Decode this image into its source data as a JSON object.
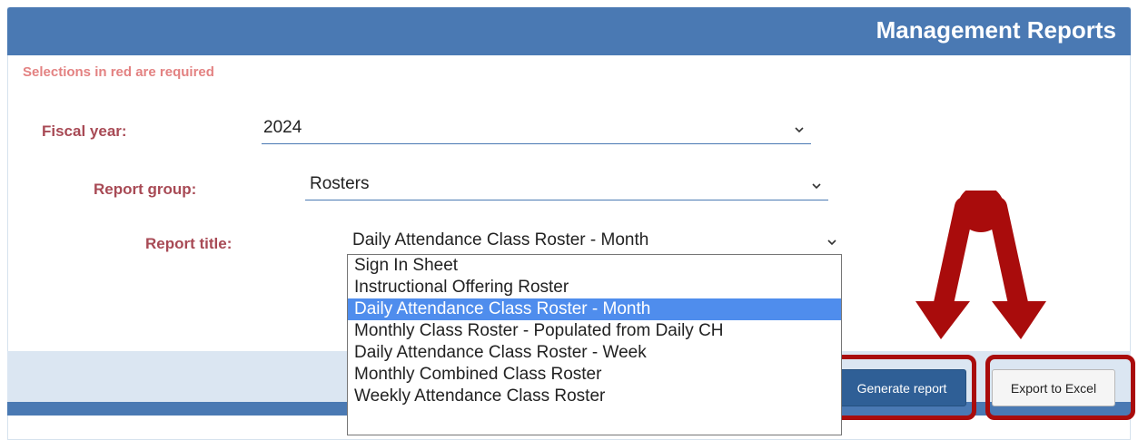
{
  "header": {
    "title": "Management Reports"
  },
  "required_note": "Selections in red are required",
  "form": {
    "fiscal_year": {
      "label": "Fiscal year:",
      "value": "2024"
    },
    "report_group": {
      "label": "Report group:",
      "value": "Rosters"
    },
    "report_title": {
      "label": "Report title:",
      "value": "Daily Attendance Class Roster - Month"
    }
  },
  "dropdown": {
    "options": [
      "Sign In Sheet",
      "Instructional Offering Roster",
      "Daily Attendance Class Roster - Month",
      "Monthly Class Roster - Populated from Daily CH",
      "Daily Attendance Class Roster - Week",
      "Monthly Combined Class Roster",
      "Weekly Attendance Class Roster"
    ],
    "selected_index": 2
  },
  "buttons": {
    "generate": "Generate report",
    "export": "Export to Excel"
  },
  "colors": {
    "header": "#4a79b3",
    "label": "#a84a55",
    "required_note": "#e38282",
    "annotation": "#a90c0c",
    "option_highlight": "#4f8ded"
  },
  "icons": {
    "select_chevron": "chevron-down-icon",
    "annotation_arrows": "red-arrows-annotation"
  }
}
